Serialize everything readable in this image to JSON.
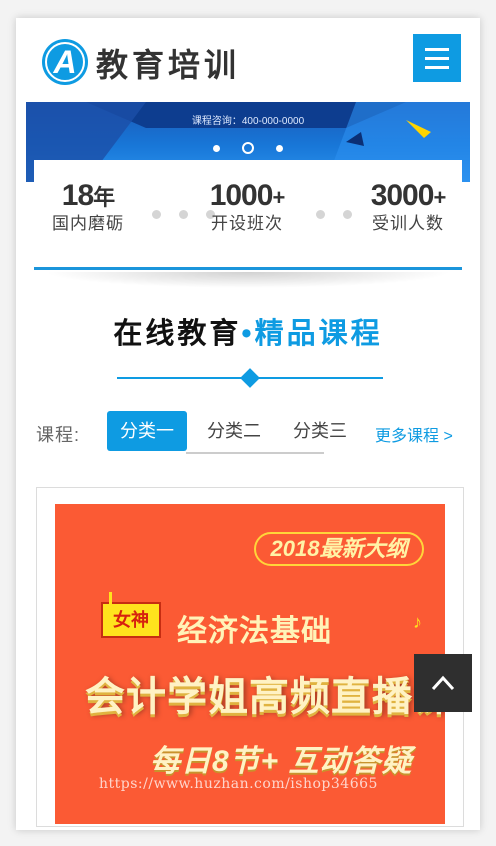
{
  "header": {
    "logo_letter": "A",
    "site_name": "教育培训",
    "menu_icon": "hamburger-icon",
    "brand_color": "#0e9be2"
  },
  "banner": {
    "consult_text": "课程咨询：400-000-0000",
    "slide_count": 3,
    "active_slide": 2
  },
  "stats": [
    {
      "number": "18",
      "unit": "年",
      "label": "国内磨砺"
    },
    {
      "number": "1000",
      "unit": "+",
      "label": "开设班次"
    },
    {
      "number": "3000",
      "unit": "+",
      "label": "受训人数"
    }
  ],
  "section": {
    "title_dark": "在线教育",
    "separator": "•",
    "title_blue": "精品课程"
  },
  "tabs": {
    "label": "课程:",
    "items": [
      "分类一",
      "分类二",
      "分类三"
    ],
    "active_index": 0,
    "more": "更多课程 >"
  },
  "course": {
    "badge": "2018最新大纲",
    "tag": "女神",
    "subtitle": "经济法基础",
    "title": "会计学姐高频直播课",
    "bottom": "每日8节+ 互动答疑",
    "watermark": "https://www.huzhan.com/ishop34665"
  },
  "back_to_top_icon": "chevron-up-icon"
}
